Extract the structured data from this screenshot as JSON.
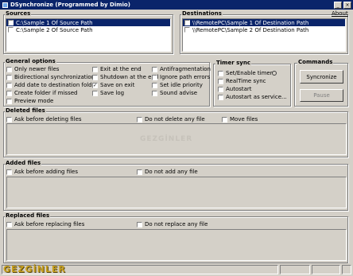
{
  "window": {
    "title": "DSynchronize (Programmed by Dimio)"
  },
  "about_label": "About",
  "sources": {
    "title": "Sources",
    "items": [
      {
        "path": "C:\\Sample 1 Of Source Path",
        "selected": true
      },
      {
        "path": "C:\\Sample 2 Of Source Path",
        "selected": false
      }
    ]
  },
  "destinations": {
    "title": "Destinations",
    "items": [
      {
        "path": "\\\\RemotePC\\Sample 1 Of Destination Path",
        "selected": true
      },
      {
        "path": "\\\\RemotePC\\Sample 2 Of Destination Path",
        "selected": false
      }
    ]
  },
  "general_options": {
    "title": "General options",
    "col1": [
      {
        "label": "Only newer files",
        "checked": false
      },
      {
        "label": "Bidirectional synchronization",
        "checked": false
      },
      {
        "label": "Add date to destination folder",
        "checked": false
      },
      {
        "label": "Create folder if missed",
        "checked": false
      },
      {
        "label": "Preview mode",
        "checked": false
      }
    ],
    "col2": [
      {
        "label": "Exit at the end",
        "checked": false
      },
      {
        "label": "Shutdown at the end",
        "checked": false
      },
      {
        "label": "Save on exit",
        "checked": true
      },
      {
        "label": "Save log",
        "checked": false
      }
    ],
    "col3": [
      {
        "label": "Antifragmentation",
        "checked": false
      },
      {
        "label": "Ignore path errors",
        "checked": false
      },
      {
        "label": "Set idle priority",
        "checked": false
      },
      {
        "label": "Sound advise",
        "checked": false
      }
    ]
  },
  "timer_sync": {
    "title": "Timer sync",
    "options": [
      {
        "label": "Set/Enable timer",
        "checked": false
      },
      {
        "label": "RealTime sync",
        "checked": false
      },
      {
        "label": "Autostart",
        "checked": false
      },
      {
        "label": "Autostart as service...",
        "checked": false
      }
    ]
  },
  "commands": {
    "title": "Commands",
    "synchronize_label": "Syncronize",
    "pause_label": "Pause"
  },
  "deleted_files": {
    "title": "Deleted files",
    "options": [
      "Ask before deleting files",
      "Do not delete any file",
      "Move files"
    ]
  },
  "added_files": {
    "title": "Added files",
    "options": [
      "Ask before adding files",
      "Do not add any file"
    ]
  },
  "replaced_files": {
    "title": "Replaced files",
    "options": [
      "Ask before replacing files",
      "Do not replace any file"
    ]
  },
  "watermark": {
    "center": "GEZGİNLER",
    "bottom": "GEZGİNLER"
  }
}
